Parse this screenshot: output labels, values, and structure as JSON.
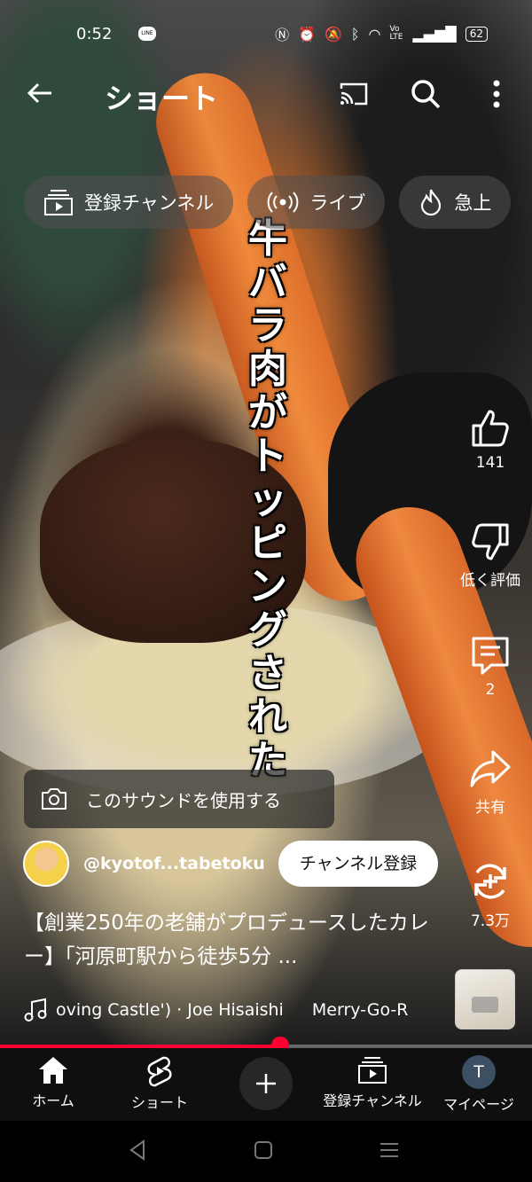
{
  "status_bar": {
    "time": "0:52",
    "line_app": "LINE",
    "volte": "Vo LTE",
    "battery": "62"
  },
  "header": {
    "title": "ショート"
  },
  "chips": [
    {
      "label": "登録チャンネル",
      "icon": "subscriptions-icon"
    },
    {
      "label": "ライブ",
      "icon": "live-icon"
    },
    {
      "label": "急上",
      "icon": "trending-icon"
    }
  ],
  "video_overlay_text": "牛バラ肉がトッピングされた",
  "actions": {
    "like_count": "141",
    "dislike_label": "低く評価",
    "comment_count": "2",
    "share_label": "共有",
    "remix_count": "7.3万"
  },
  "sound_button": {
    "label": "このサウンドを使用する"
  },
  "channel": {
    "handle": "@kyotof...tabetoku",
    "subscribe_label": "チャンネル登録"
  },
  "video_title": "【創業250年の老舗がプロデュースしたカレー】「河原町駅から徒歩5分 ...",
  "music": {
    "track": "oving Castle') · Joe Hisaishi",
    "track2": "Merry-Go-R"
  },
  "progress_fraction": 0.527,
  "bottom_nav": {
    "home": "ホーム",
    "shorts": "ショート",
    "subscriptions": "登録チャンネル",
    "profile": "マイページ",
    "profile_initial": "T"
  },
  "colors": {
    "accent": "#ff0033",
    "background": "#0f0f0f"
  }
}
